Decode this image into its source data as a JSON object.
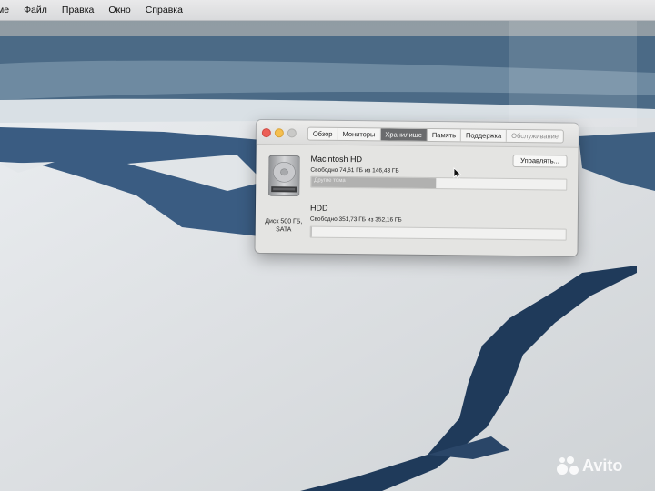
{
  "menubar": {
    "items": [
      "ме",
      "Файл",
      "Правка",
      "Окно",
      "Справка"
    ]
  },
  "window": {
    "tabs": [
      {
        "label": "Обзор",
        "active": false
      },
      {
        "label": "Мониторы",
        "active": false
      },
      {
        "label": "Хранилище",
        "active": true
      },
      {
        "label": "Память",
        "active": false
      },
      {
        "label": "Поддержка",
        "active": false
      },
      {
        "label": "Обслуживание",
        "active": false
      }
    ],
    "disk": {
      "label_line1": "Диск 500 ГБ,",
      "label_line2": "SATA",
      "icon": "hard-drive-icon"
    },
    "volumes": [
      {
        "name": "Macintosh HD",
        "free_text": "Свободно 74,61 ГБ из 146,43 ГБ",
        "used_fraction": 0.49,
        "bar_label": "Другие тома"
      },
      {
        "name": "HDD",
        "free_text": "Свободно 351,73 ГБ из 352,16 ГБ",
        "used_fraction": 0.001
      }
    ],
    "manage_button": "Управлять..."
  },
  "watermark": {
    "text": "Avito"
  },
  "colors": {
    "active_tab": "#6a6b6d",
    "close_light": "#ec5f57",
    "minimize_light": "#f5bf4f"
  }
}
